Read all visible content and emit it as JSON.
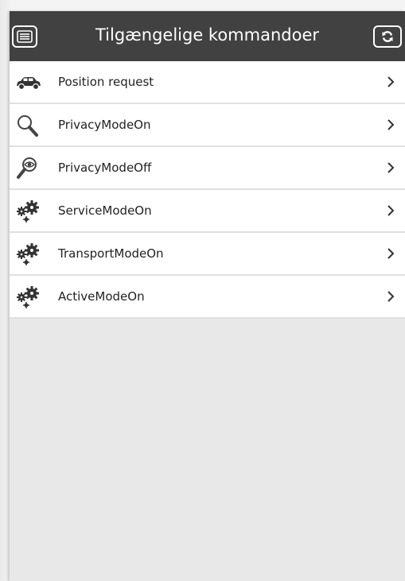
{
  "header": {
    "title": "Tilgængelige kommandoer",
    "menu_icon": "menu-icon",
    "refresh_icon": "refresh-icon"
  },
  "commands": [
    {
      "label": "Position request",
      "icon": "car-icon"
    },
    {
      "label": "PrivacyModeOn",
      "icon": "magnifier-icon"
    },
    {
      "label": "PrivacyModeOff",
      "icon": "magnifier-eye-icon"
    },
    {
      "label": "ServiceModeOn",
      "icon": "gears-icon"
    },
    {
      "label": "TransportModeOn",
      "icon": "gears-icon"
    },
    {
      "label": "ActiveModeOn",
      "icon": "gears-icon"
    }
  ],
  "colors": {
    "header_bg": "#414141",
    "list_bg": "#ffffff",
    "empty_bg": "#e8e8e8"
  }
}
